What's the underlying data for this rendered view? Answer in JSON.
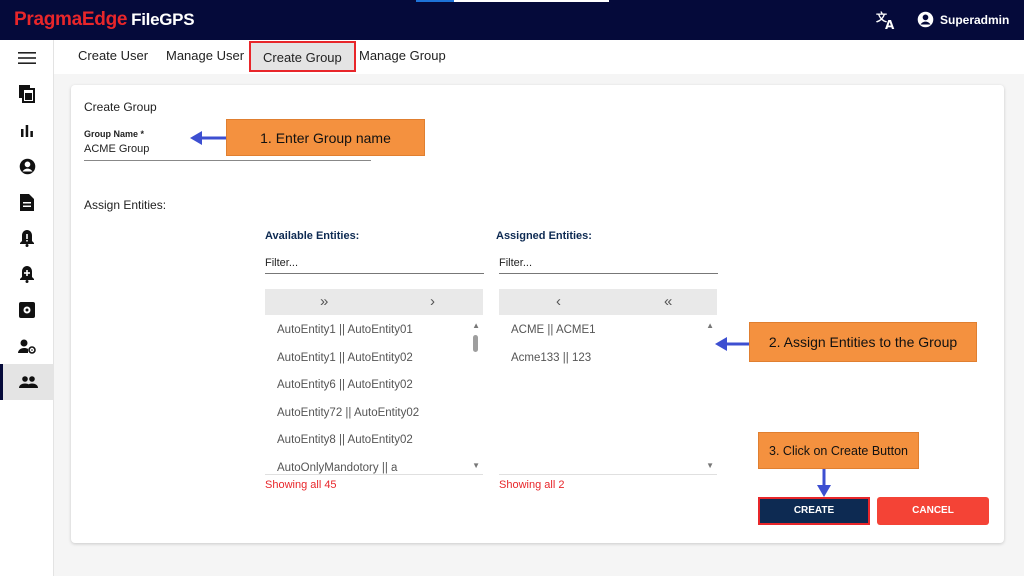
{
  "header": {
    "brand": "PragmaEdge",
    "product": "FileGPS",
    "user": "Superadmin",
    "icons": [
      "translate-icon",
      "account-circle-icon"
    ]
  },
  "sidebar": {
    "items": [
      {
        "name": "menu-icon"
      },
      {
        "name": "files-icon"
      },
      {
        "name": "bar-chart-icon"
      },
      {
        "name": "account-icon"
      },
      {
        "name": "document-icon"
      },
      {
        "name": "alert-bell-icon"
      },
      {
        "name": "add-alert-icon"
      },
      {
        "name": "settings-box-icon"
      },
      {
        "name": "user-settings-icon"
      },
      {
        "name": "groups-icon",
        "active": true
      }
    ]
  },
  "tabs": [
    {
      "label": "Create User"
    },
    {
      "label": "Manage User"
    },
    {
      "label": "Create Group",
      "selected": true
    },
    {
      "label": "Manage Group"
    }
  ],
  "form": {
    "title": "Create Group",
    "group_name_label": "Group Name *",
    "group_name_value": "ACME Group",
    "assign_label": "Assign Entities:"
  },
  "available": {
    "heading": "Available Entities:",
    "filter_placeholder": "Filter...",
    "btn_move_all": "»",
    "btn_move": "›",
    "items": [
      "AutoEntity1 || AutoEntity01",
      "AutoEntity1 || AutoEntity02",
      "AutoEntity6 || AutoEntity02",
      "AutoEntity72 || AutoEntity02",
      "AutoEntity8 || AutoEntity02",
      "AutoOnlyMandotory || a"
    ],
    "showing": "Showing all 45"
  },
  "assigned": {
    "heading": "Assigned Entities:",
    "filter_placeholder": "Filter...",
    "btn_remove": "‹",
    "btn_remove_all": "«",
    "items": [
      "ACME || ACME1",
      "Acme133 || 123"
    ],
    "showing": "Showing all 2"
  },
  "buttons": {
    "create": "CREATE",
    "cancel": "CANCEL"
  },
  "annotations": {
    "step1": "1. Enter Group name",
    "step2": "2. Assign Entities to the Group",
    "step3": "3. Click on Create Button"
  },
  "colors": {
    "navy": "#050a3a",
    "brand_red": "#e8262a",
    "primary_button": "#0d2a52",
    "cancel_button": "#f44336",
    "callout": "#f4913f",
    "arrow": "#3d4fd1"
  }
}
